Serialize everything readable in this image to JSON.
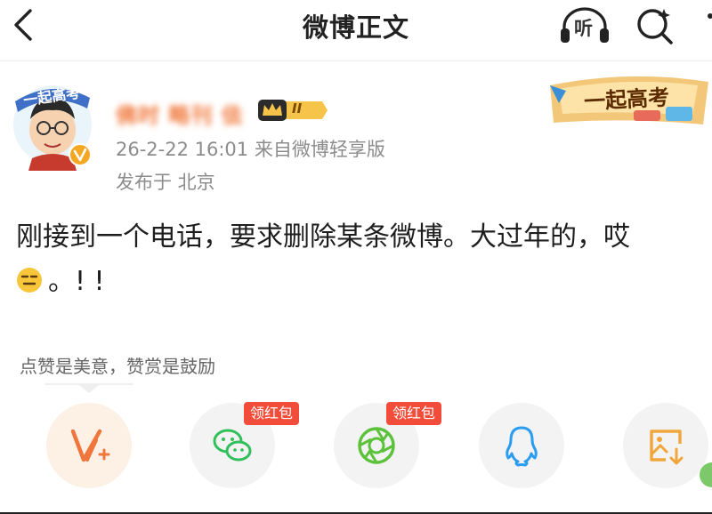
{
  "header": {
    "title": "微博正文",
    "listen_label": "听",
    "icons": [
      "back-arrow-icon",
      "headphones-icon",
      "search-icon",
      "more-icon"
    ]
  },
  "post": {
    "avatar_caption": "一起高考",
    "username": "佛时 略刊 佉",
    "vip_level": "II",
    "time_source": "26-2-22 16:01  来自微博轻享版",
    "location": "发布于 北京",
    "badge_text": "一起高考",
    "content_text": "刚接到一个电话，要求删除某条微博。大过年的，哎",
    "content_tail": "。! !",
    "emoji": "expressionless-face-icon"
  },
  "reward": {
    "hint": "点赞是美意，赞赏是鼓励"
  },
  "share": {
    "redpack_label": "领红包",
    "items": [
      "vplus-icon",
      "wechat-icon",
      "moments-icon",
      "qq-icon",
      "save-image-icon"
    ]
  },
  "colors": {
    "accent": "#f0773b",
    "redpack": "#f14d3a",
    "wechat": "#2fc05a",
    "moments": "#5cc23b",
    "qq": "#2a9cf2",
    "save_image": "#f0a63a",
    "meta_text": "#8c8c8c"
  }
}
